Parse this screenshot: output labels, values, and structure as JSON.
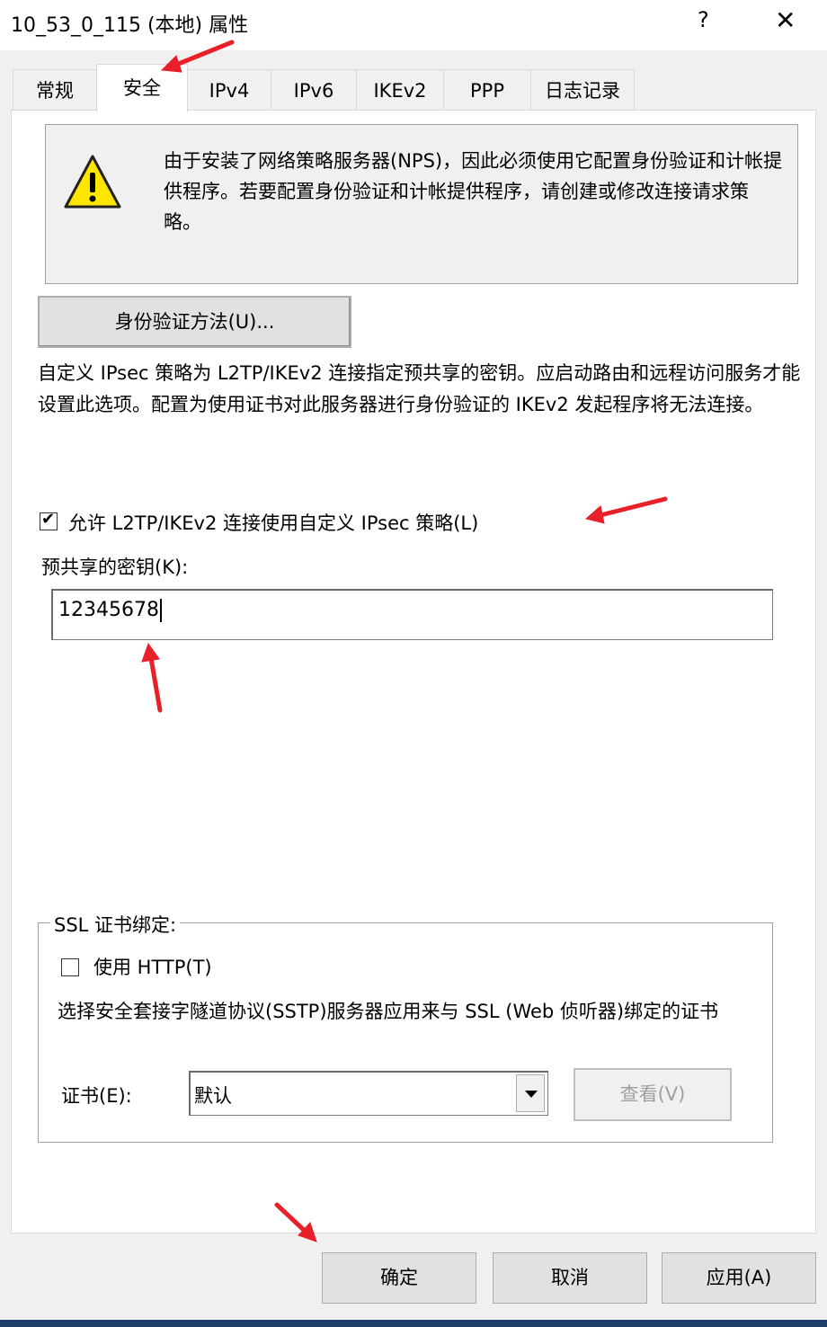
{
  "window": {
    "title": "10_53_0_115 (本地) 属性",
    "help_glyph": "?",
    "close_glyph": "✕"
  },
  "tabs": [
    {
      "label": "常规",
      "active": false
    },
    {
      "label": "安全",
      "active": true
    },
    {
      "label": "IPv4",
      "active": false
    },
    {
      "label": "IPv6",
      "active": false
    },
    {
      "label": "IKEv2",
      "active": false
    },
    {
      "label": "PPP",
      "active": false
    },
    {
      "label": "日志记录",
      "active": false
    }
  ],
  "info": {
    "icon": "warning-icon",
    "text": "由于安装了网络策略服务器(NPS)，因此必须使用它配置身份验证和计帐提供程序。若要配置身份验证和计帐提供程序，请创建或修改连接请求策略。"
  },
  "auth_button": {
    "label": "身份验证方法(U)..."
  },
  "description": "自定义 IPsec 策略为 L2TP/IKEv2 连接指定预共享的密钥。应启动路由和远程访问服务才能设置此选项。配置为使用证书对此服务器进行身份验证的 IKEv2 发起程序将无法连接。",
  "ipsec": {
    "checkbox_label": "允许 L2TP/IKEv2 连接使用自定义 IPsec 策略(L)",
    "checked": true,
    "checkmark": "✔"
  },
  "psk": {
    "label": "预共享的密钥(K):",
    "value": "12345678"
  },
  "ssl": {
    "group_title": "SSL 证书绑定:",
    "http_label": "使用 HTTP(T)",
    "http_checked": false,
    "description": "选择安全套接字隧道协议(SSTP)服务器应用来与 SSL (Web 侦听器)绑定的证书",
    "cert_label": "证书(E):",
    "cert_value": "默认",
    "view_button": "查看(V)"
  },
  "footer": {
    "ok": "确定",
    "cancel": "取消",
    "apply": "应用(A)"
  },
  "annotation_color": "#e8202a"
}
